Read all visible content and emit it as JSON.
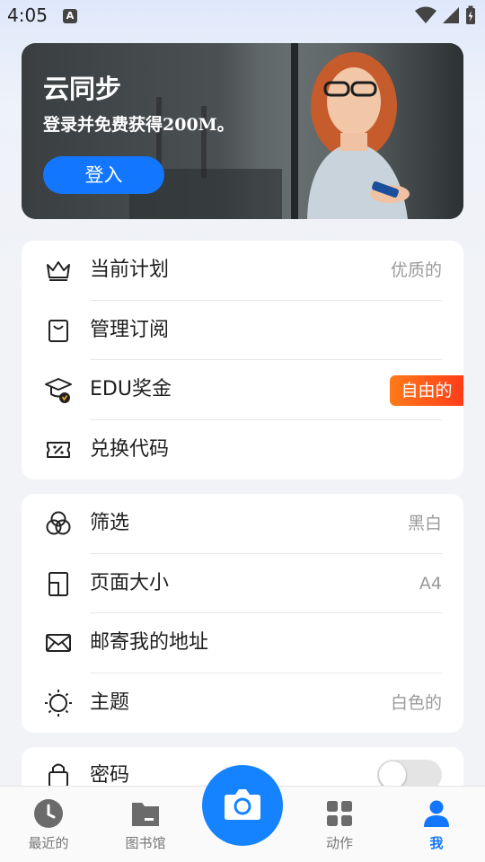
{
  "status_bar": {
    "time": "4:05",
    "notification_badge": "A"
  },
  "banner": {
    "title": "云同步",
    "subtitle": "登录并免费获得200M。",
    "login_label": "登入",
    "accent": "#1276ff"
  },
  "account_section": {
    "items": [
      {
        "icon": "crown-icon",
        "label": "当前计划",
        "value": "优质的"
      },
      {
        "icon": "shopping-bag-icon",
        "label": "管理订阅",
        "value": ""
      },
      {
        "icon": "graduation-cap-icon",
        "label": "EDU奖金",
        "badge": "自由的"
      },
      {
        "icon": "ticket-icon",
        "label": "兑换代码",
        "value": ""
      }
    ]
  },
  "settings_section": {
    "items": [
      {
        "icon": "filter-circles-icon",
        "label": "筛选",
        "value": "黑白"
      },
      {
        "icon": "page-size-icon",
        "label": "页面大小",
        "value": "A4"
      },
      {
        "icon": "mail-icon",
        "label": "邮寄我的地址",
        "value": ""
      },
      {
        "icon": "sun-icon",
        "label": "主题",
        "value": "白色的"
      }
    ]
  },
  "security_section": {
    "items": [
      {
        "icon": "lock-icon",
        "label": "密码",
        "toggle_on": false
      }
    ]
  },
  "bottom_nav": {
    "items": [
      {
        "icon": "clock-icon",
        "label": "最近的",
        "active": false
      },
      {
        "icon": "folder-icon",
        "label": "图书馆",
        "active": false
      },
      {
        "icon": "grid-icon",
        "label": "动作",
        "active": false
      },
      {
        "icon": "person-icon",
        "label": "我",
        "active": true
      }
    ],
    "camera_icon": "camera-icon",
    "active_color": "#1276ff"
  }
}
